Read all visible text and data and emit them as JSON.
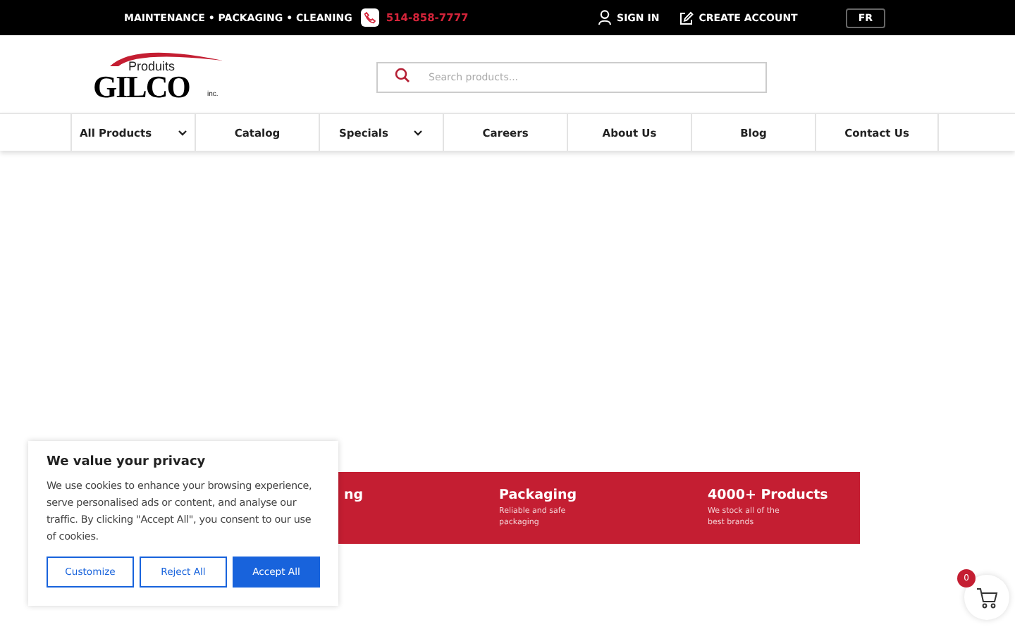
{
  "top_bar": {
    "tagline": "MAINTENANCE • PACKAGING • CLEANING",
    "phone": "514-858-7777",
    "links": [
      {
        "kind": "user",
        "label": "SIGN IN"
      },
      {
        "kind": "edit",
        "label": "CREATE ACCOUNT"
      }
    ],
    "language": "FR"
  },
  "logo": {
    "top": "Produits",
    "name": "GILCO",
    "suffix": "inc."
  },
  "search": {
    "placeholder": "Search products..."
  },
  "nav": [
    {
      "label": "All Products",
      "dropdown": true
    },
    {
      "label": "Catalog",
      "dropdown": false
    },
    {
      "label": "Specials",
      "dropdown": true
    },
    {
      "label": "Careers",
      "dropdown": false
    },
    {
      "label": "About Us",
      "dropdown": false
    },
    {
      "label": "Blog",
      "dropdown": false
    },
    {
      "label": "Contact Us",
      "dropdown": false
    }
  ],
  "features": [
    {
      "title": "ng"
    },
    {
      "title": "Packaging",
      "text": "Reliable and safe packaging"
    },
    {
      "title": "4000+ Products",
      "text": "We stock all of the best brands"
    }
  ],
  "cookie_dialog": {
    "title": "We value your privacy",
    "text": "We use cookies to enhance your browsing experience, serve personalised ads or content, and analyse our traffic. By clicking \"Accept All\", you consent to our use of cookies.",
    "buttons": [
      {
        "label": "Customize",
        "primary": false
      },
      {
        "label": "Reject All",
        "primary": false
      },
      {
        "label": "Accept All",
        "primary": true
      }
    ]
  },
  "cart": {
    "count": "0"
  }
}
